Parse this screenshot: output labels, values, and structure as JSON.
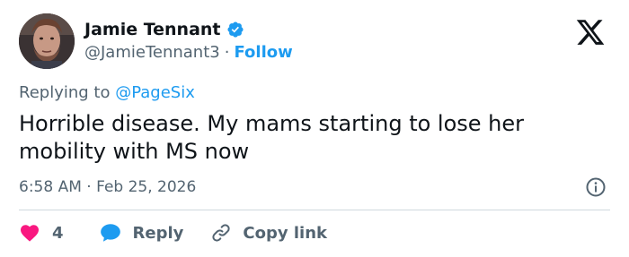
{
  "author": {
    "display_name": "Jamie Tennant",
    "handle": "@JamieTennant3",
    "separator": "·",
    "follow_label": "Follow",
    "verified": true
  },
  "tweet": {
    "replying_prefix": "Replying to",
    "replying_to": "@PageSix",
    "text": "Horrible disease. My mams starting to lose her mobility with MS now",
    "time": "6:58 AM",
    "date_separator": "·",
    "date": "Feb 25, 2026"
  },
  "actions": {
    "like_count": "4",
    "reply_label": "Reply",
    "copy_link_label": "Copy link"
  },
  "icons": {
    "verified": "verified-badge-icon",
    "logo": "x-logo-icon",
    "info": "info-icon",
    "like": "heart-icon",
    "reply": "speech-bubble-icon",
    "copy": "link-icon"
  },
  "colors": {
    "accent": "#1d9bf0",
    "like": "#f91880",
    "text": "#0f1419",
    "secondary": "#536471",
    "divider": "#cfd9de"
  }
}
